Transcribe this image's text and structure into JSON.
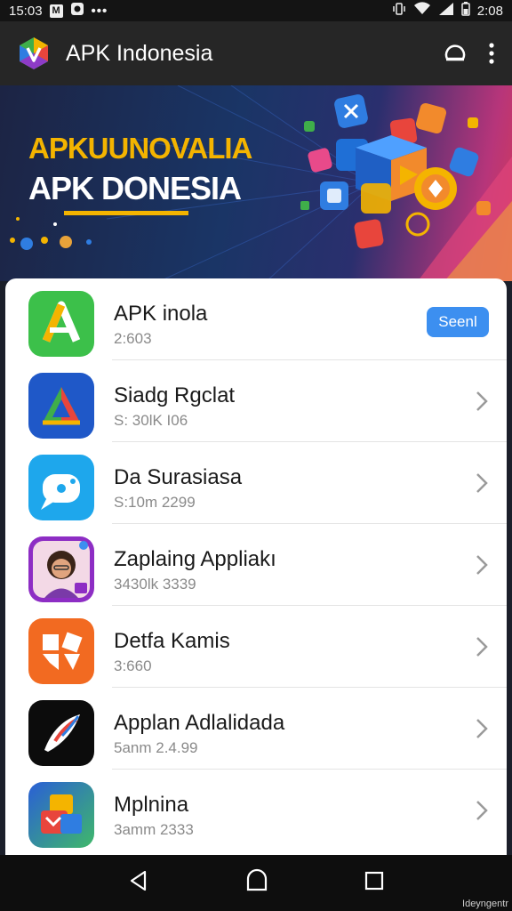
{
  "status_bar": {
    "time": "15:03",
    "notif_letter": "M",
    "overflow": "•••",
    "right_time": "2:08"
  },
  "header": {
    "title": "APK Indonesia"
  },
  "banner": {
    "line1": "APKUUNOVALIA",
    "line2": "APK DONESIA"
  },
  "apps": [
    {
      "name": "APK inola",
      "meta": "2:603",
      "action": "Seenl"
    },
    {
      "name": "Siadg Rgclat",
      "meta": "S: 30lK    I06"
    },
    {
      "name": "Da Surasiasa",
      "meta": "S:10m   2299"
    },
    {
      "name": "Zaplaing Appliakı",
      "meta": "3430lk   3339"
    },
    {
      "name": "Detfa Kamis",
      "meta": "3:660"
    },
    {
      "name": "Applan Adlalidada",
      "meta": "5anm   2.4.99"
    },
    {
      "name": "Mplnina",
      "meta": "3amm   2333"
    }
  ],
  "watermark": "Ideyngentr",
  "colors": {
    "accent": "#3c8ff0",
    "banner_yellow": "#f4b400",
    "app_bar": "#262626"
  }
}
